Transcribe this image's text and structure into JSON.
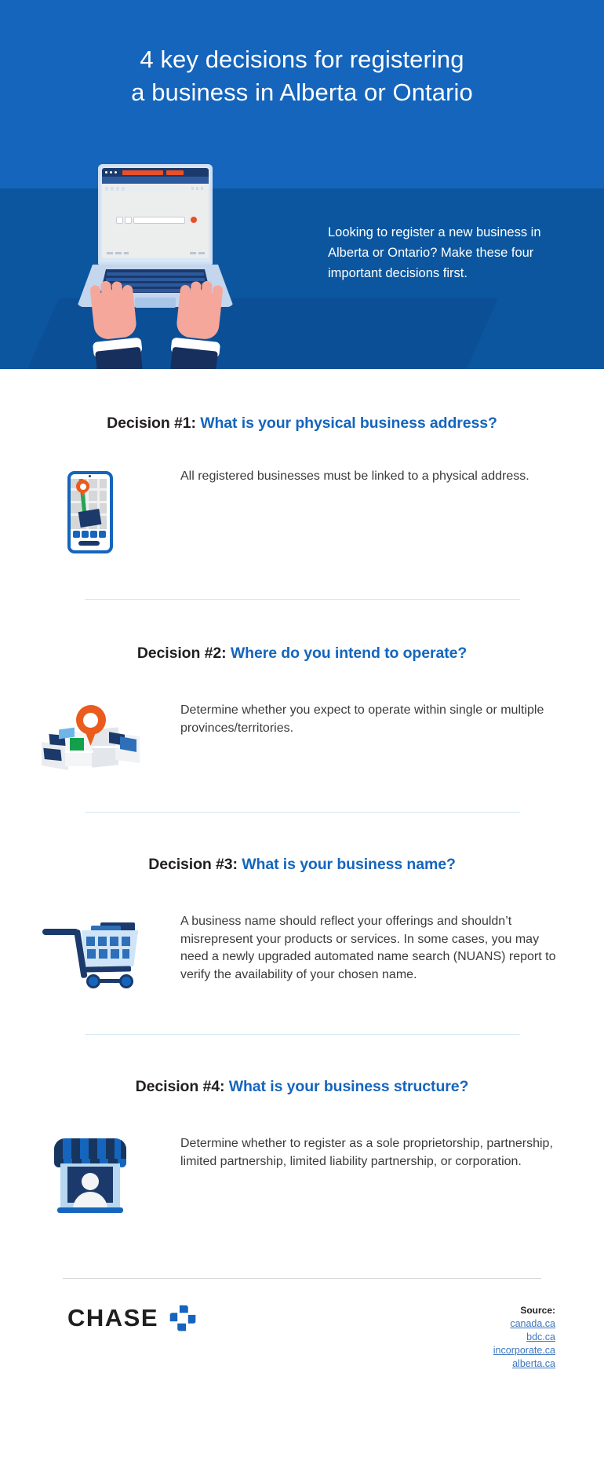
{
  "hero": {
    "title_line1": "4 key decisions for registering",
    "title_line2": "a business in Alberta or Ontario",
    "intro": "Looking to register a new business in Alberta or Ontario? Make these four important decisions first.",
    "bg_color": "#1565bd",
    "bg_color_lower": "#0b569f",
    "title_color": "#ffffff"
  },
  "decisions": [
    {
      "label": "Decision #1:",
      "question": "What is your physical business address?",
      "body": "All registered businesses must be linked to a physical address.",
      "icon": "phone-map-icon"
    },
    {
      "label": "Decision #2:",
      "question": "Where do you intend to operate?",
      "body": "Determine whether you expect to operate within single or multiple provinces/territories.",
      "icon": "folded-map-pin-icon"
    },
    {
      "label": "Decision #3:",
      "question": "What is your business name?",
      "body": "A business name should reflect your offerings and shouldn’t misrepresent your products or services. In some cases, you may need a newly upgraded automated name search (NUANS) report to verify the availability of your chosen name.",
      "icon": "shopping-cart-icon"
    },
    {
      "label": "Decision #4:",
      "question": "What is your business structure?",
      "body": "Determine whether to register as a sole proprietorship, partnership, limited partnership, limited liability partnership, or corporation.",
      "icon": "storefront-icon"
    }
  ],
  "footer": {
    "brand": "CHASE",
    "source_label": "Source:",
    "sources": [
      "canada.ca",
      "bdc.ca",
      "incorporate.ca",
      "alberta.ca"
    ],
    "accent_color": "#1565bd",
    "link_color": "#3d77bd"
  }
}
